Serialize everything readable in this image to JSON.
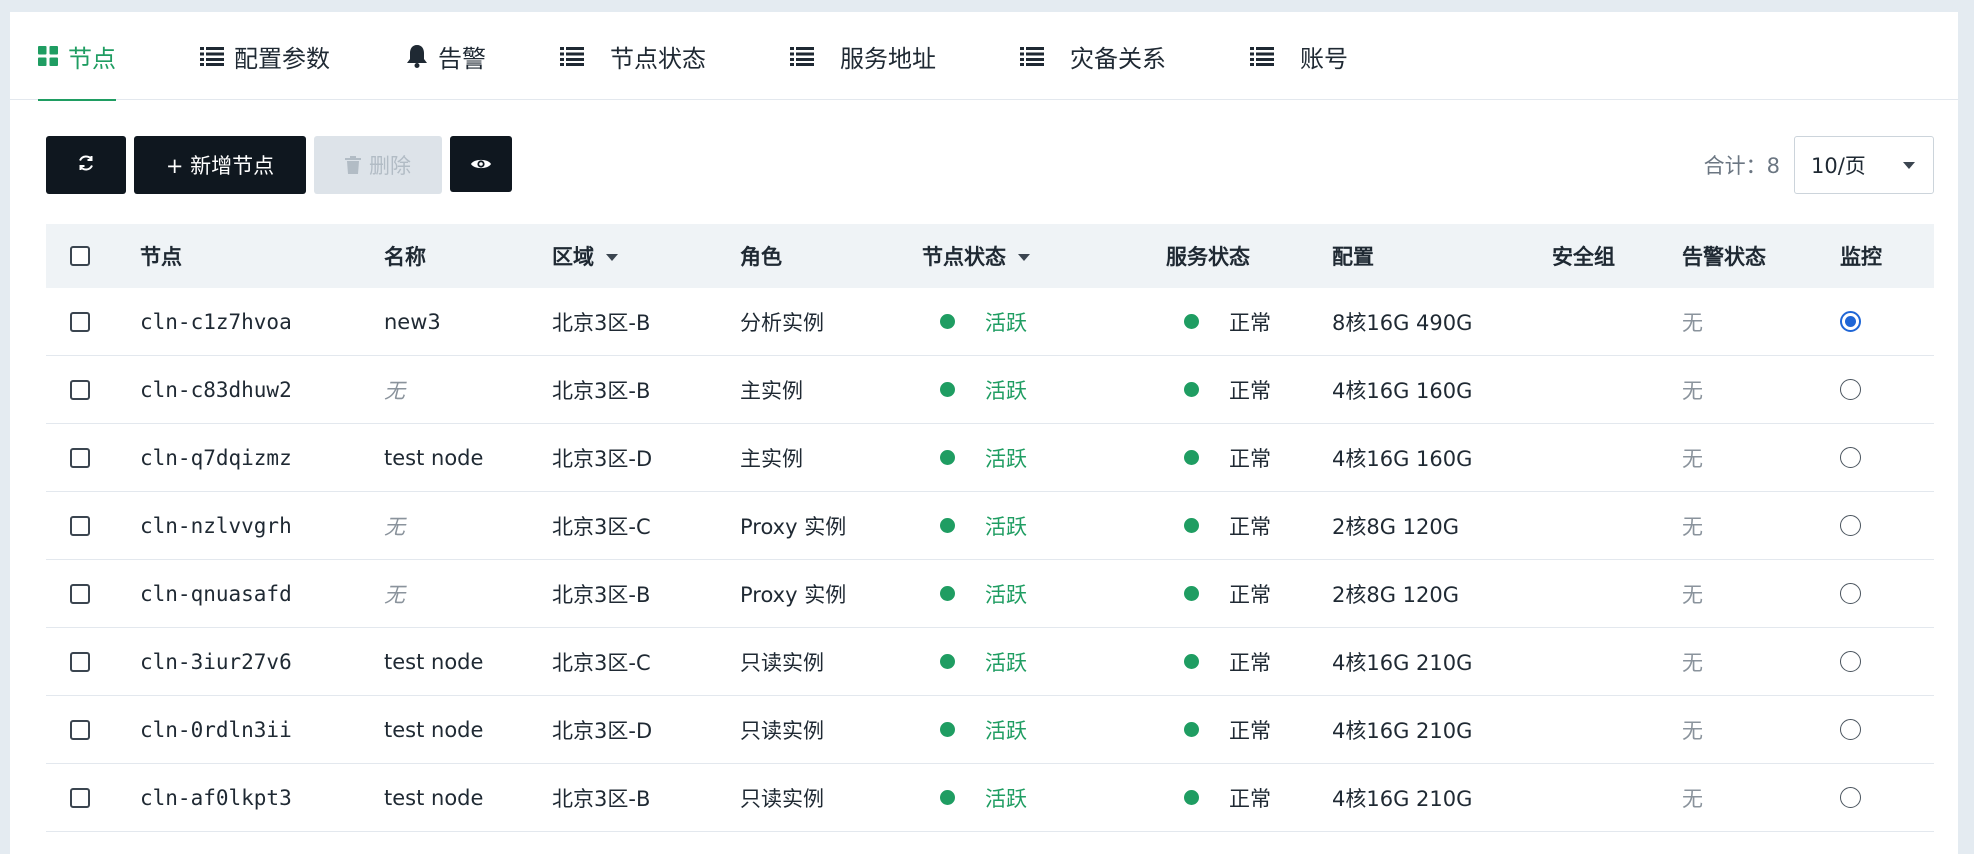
{
  "tabs": [
    {
      "label": "节点",
      "icon": "grid-icon",
      "active": true
    },
    {
      "label": "配置参数",
      "icon": "list-icon"
    },
    {
      "label": "告警",
      "icon": "bell-icon"
    },
    {
      "label": "节点状态",
      "icon": "list-icon"
    },
    {
      "label": "服务地址",
      "icon": "list-icon"
    },
    {
      "label": "灾备关系",
      "icon": "list-icon"
    },
    {
      "label": "账号",
      "icon": "list-icon"
    }
  ],
  "toolbar": {
    "refresh_icon": "refresh-icon",
    "add_label": "+ 新增节点",
    "delete_label": "删除",
    "delete_icon": "trash-icon",
    "view_icon": "eye-icon",
    "total_label": "合计：8",
    "page_size": "10/页"
  },
  "table": {
    "headers": {
      "node": "节点",
      "name": "名称",
      "zone": "区域",
      "role": "角色",
      "node_status": "节点状态",
      "service_status": "服务状态",
      "config": "配置",
      "security_group": "安全组",
      "alarm_status": "告警状态",
      "monitor": "监控"
    },
    "rows": [
      {
        "node": "cln-c1z7hvoa",
        "name": "new3",
        "zone": "北京3区-B",
        "role": "分析实例",
        "node_status": "活跃",
        "service_status": "正常",
        "config": "8核16G 490G",
        "security_group": "",
        "alarm_status": "无",
        "monitor_selected": true
      },
      {
        "node": "cln-c83dhuw2",
        "name": "无",
        "zone": "北京3区-B",
        "role": "主实例",
        "node_status": "活跃",
        "service_status": "正常",
        "config": "4核16G 160G",
        "security_group": "",
        "alarm_status": "无",
        "monitor_selected": false
      },
      {
        "node": "cln-q7dqizmz",
        "name": "test node",
        "zone": "北京3区-D",
        "role": "主实例",
        "node_status": "活跃",
        "service_status": "正常",
        "config": "4核16G 160G",
        "security_group": "",
        "alarm_status": "无",
        "monitor_selected": false
      },
      {
        "node": "cln-nzlvvgrh",
        "name": "无",
        "zone": "北京3区-C",
        "role": "Proxy 实例",
        "node_status": "活跃",
        "service_status": "正常",
        "config": "2核8G 120G",
        "security_group": "",
        "alarm_status": "无",
        "monitor_selected": false
      },
      {
        "node": "cln-qnuasafd",
        "name": "无",
        "zone": "北京3区-B",
        "role": "Proxy 实例",
        "node_status": "活跃",
        "service_status": "正常",
        "config": "2核8G 120G",
        "security_group": "",
        "alarm_status": "无",
        "monitor_selected": false
      },
      {
        "node": "cln-3iur27v6",
        "name": "test node",
        "zone": "北京3区-C",
        "role": "只读实例",
        "node_status": "活跃",
        "service_status": "正常",
        "config": "4核16G 210G",
        "security_group": "",
        "alarm_status": "无",
        "monitor_selected": false
      },
      {
        "node": "cln-0rdln3ii",
        "name": "test node",
        "zone": "北京3区-D",
        "role": "只读实例",
        "node_status": "活跃",
        "service_status": "正常",
        "config": "4核16G 210G",
        "security_group": "",
        "alarm_status": "无",
        "monitor_selected": false
      },
      {
        "node": "cln-af0lkpt3",
        "name": "test node",
        "zone": "北京3区-B",
        "role": "只读实例",
        "node_status": "活跃",
        "service_status": "正常",
        "config": "4核16G 210G",
        "security_group": "",
        "alarm_status": "无",
        "monitor_selected": false
      }
    ]
  },
  "colors": {
    "accent": "#1f9d62",
    "status_dot": "#1f9d62",
    "radio_selected": "#1f66d6",
    "button_dark": "#0f171f",
    "header_bg": "#eff3f6"
  }
}
